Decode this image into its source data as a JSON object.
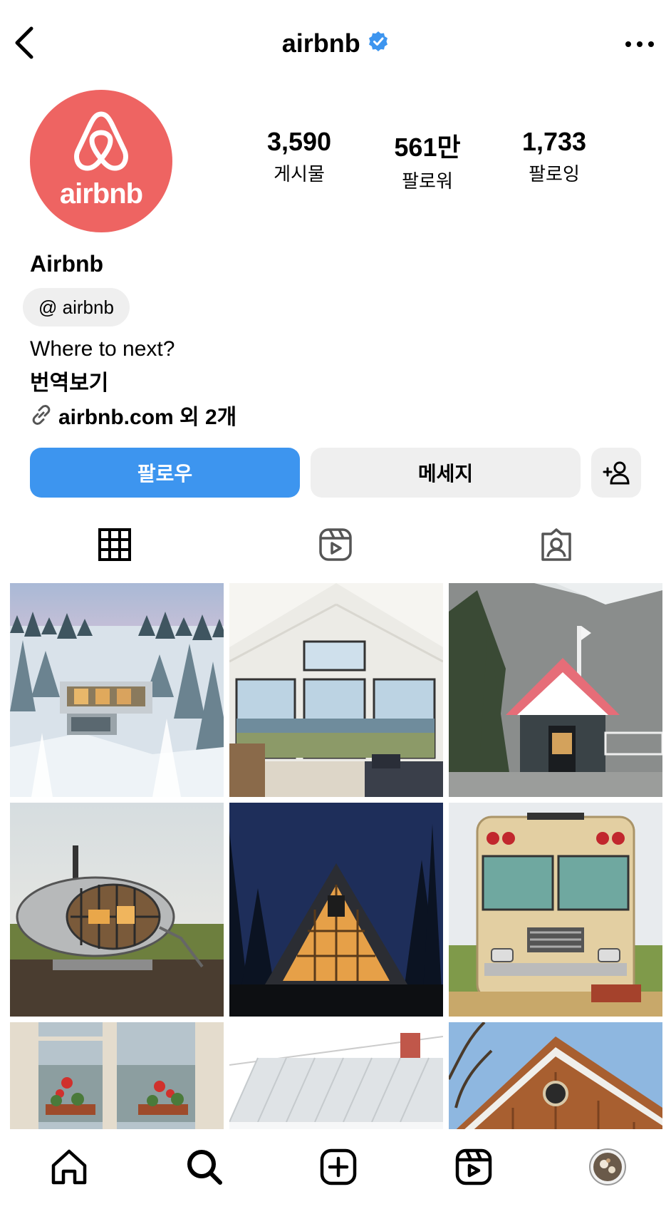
{
  "header": {
    "title": "airbnb",
    "verified": true
  },
  "profile": {
    "avatar_text": "airbnb",
    "brand_color": "#EE6462",
    "display_name": "Airbnb",
    "handle": "@ airbnb",
    "bio": "Where to next?",
    "translate_label": "번역보기",
    "link_text": "airbnb.com 외 2개"
  },
  "stats": [
    {
      "value": "3,590",
      "label": "게시물"
    },
    {
      "value": "561만",
      "label": "팔로워"
    },
    {
      "value": "1,733",
      "label": "팔로잉"
    }
  ],
  "actions": {
    "follow_label": "팔로우",
    "message_label": "메세지",
    "follow_color": "#3D95EF"
  },
  "tabs": [
    {
      "icon": "grid-icon",
      "active": true
    },
    {
      "icon": "reels-icon",
      "active": false
    },
    {
      "icon": "tagged-icon",
      "active": false
    }
  ],
  "posts": [
    {
      "subject": "snowy-forest-house"
    },
    {
      "subject": "ocean-view-living-room"
    },
    {
      "subject": "mountain-temple-house"
    },
    {
      "subject": "spaceship-home"
    },
    {
      "subject": "a-frame-cabin-night"
    },
    {
      "subject": "school-bus-home"
    },
    {
      "subject": "window-flowers-lake"
    },
    {
      "subject": "white-roof-chimney"
    },
    {
      "subject": "wooden-cabin-roof"
    }
  ],
  "bottom_nav": [
    {
      "icon": "home-icon"
    },
    {
      "icon": "search-icon"
    },
    {
      "icon": "create-icon"
    },
    {
      "icon": "reels-icon"
    },
    {
      "icon": "profile-avatar"
    }
  ]
}
